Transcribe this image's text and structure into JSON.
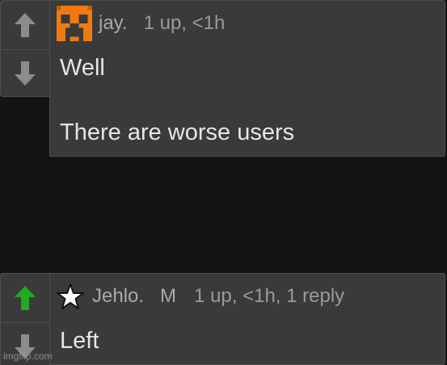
{
  "comments": [
    {
      "username": "jay.",
      "meta": "1 up, <1h",
      "lines": [
        "Well",
        "There are worse users"
      ],
      "upvoted": false,
      "avatar": "orange-creeper-face"
    },
    {
      "username": "Jehlo.",
      "mod_flag": "M",
      "meta": "1 up, <1h, 1 reply",
      "lines": [
        "Left"
      ],
      "upvoted": true,
      "avatar": "star-icon"
    }
  ],
  "watermark": "imgflip.com",
  "colors": {
    "background": "#141414",
    "panel": "#3a3a3a",
    "border": "#4e4e4e",
    "arrow_default": "#8c8c8c",
    "arrow_upvoted": "#22aa22",
    "avatar_orange": "#f07a10"
  }
}
